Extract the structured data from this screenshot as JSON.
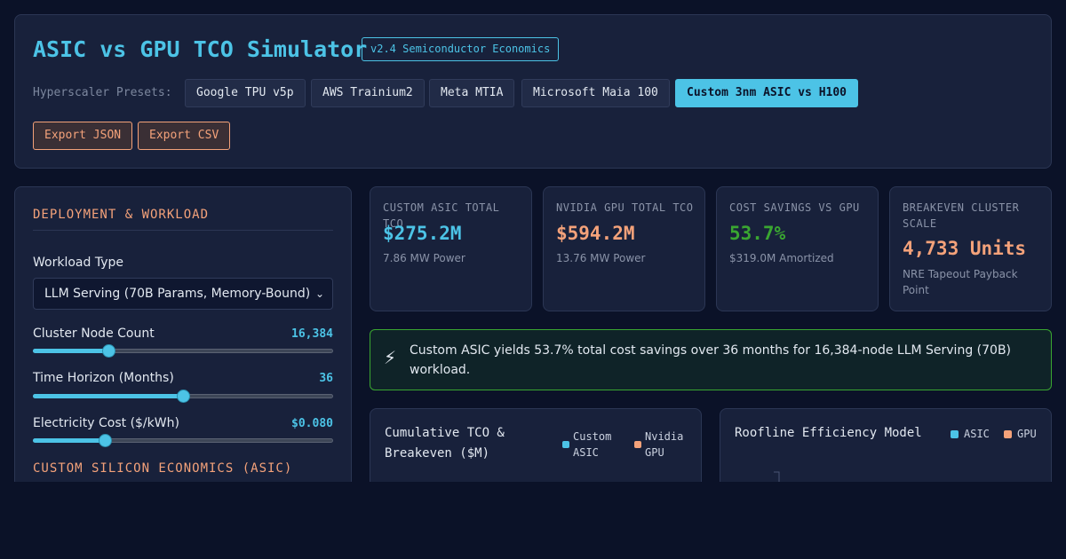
{
  "header": {
    "title": "ASIC vs GPU TCO Simulator",
    "version": "v2.4 Semiconductor Economics",
    "presets_label": "Hyperscaler Presets:",
    "presets": [
      "Google TPU v5p",
      "AWS Trainium2",
      "Meta MTIA",
      "Microsoft Maia 100",
      "Custom 3nm ASIC vs H100"
    ],
    "active_preset": "Custom 3nm ASIC vs H100",
    "export_json": "Export JSON",
    "export_csv": "Export CSV"
  },
  "deployment": {
    "section_title": "DEPLOYMENT & WORKLOAD",
    "workload_label": "Workload Type",
    "workload_value": "LLM Serving (70B Params, Memory-Bound)",
    "node_count_label": "Cluster Node Count",
    "node_count_value": "16,384",
    "node_count_fraction": 0.25,
    "horizon_label": "Time Horizon (Months)",
    "horizon_value": "36",
    "horizon_fraction": 0.5,
    "electricity_label": "Electricity Cost ($/kWh)",
    "electricity_value": "$0.080",
    "electricity_fraction": 0.24,
    "next_section_title": "CUSTOM SILICON ECONOMICS (ASIC)"
  },
  "kpis": [
    {
      "label": "CUSTOM ASIC TOTAL TCO",
      "value": "$275.2M",
      "sub": "7.86 MW Power",
      "color": "#4cc3e6"
    },
    {
      "label": "NVIDIA GPU TOTAL TCO",
      "value": "$594.2M",
      "sub": "13.76 MW Power",
      "color": "#f4a27a"
    },
    {
      "label": "COST SAVINGS VS GPU",
      "value": "53.7%",
      "sub": "$319.0M Amortized",
      "color": "#3aa631"
    },
    {
      "label": "BREAKEVEN CLUSTER SCALE",
      "value": "4,733 Units",
      "sub": "NRE Tapeout Payback Point",
      "color": "#f4a27a"
    }
  ],
  "banner": {
    "icon": "lightning-icon",
    "text": "Custom ASIC yields 53.7% total cost savings over 36 months for 16,384-node LLM Serving (70B) workload."
  },
  "charts": {
    "tco_title": "Cumulative TCO & Breakeven ($M)",
    "tco_legend_asic": "Custom ASIC",
    "tco_legend_gpu": "Nvidia GPU",
    "roofline_title": "Roofline Efficiency Model",
    "roofline_legend_asic": "ASIC",
    "roofline_legend_gpu": "GPU",
    "asic_color": "#4cc3e6",
    "gpu_color": "#f4a27a"
  }
}
